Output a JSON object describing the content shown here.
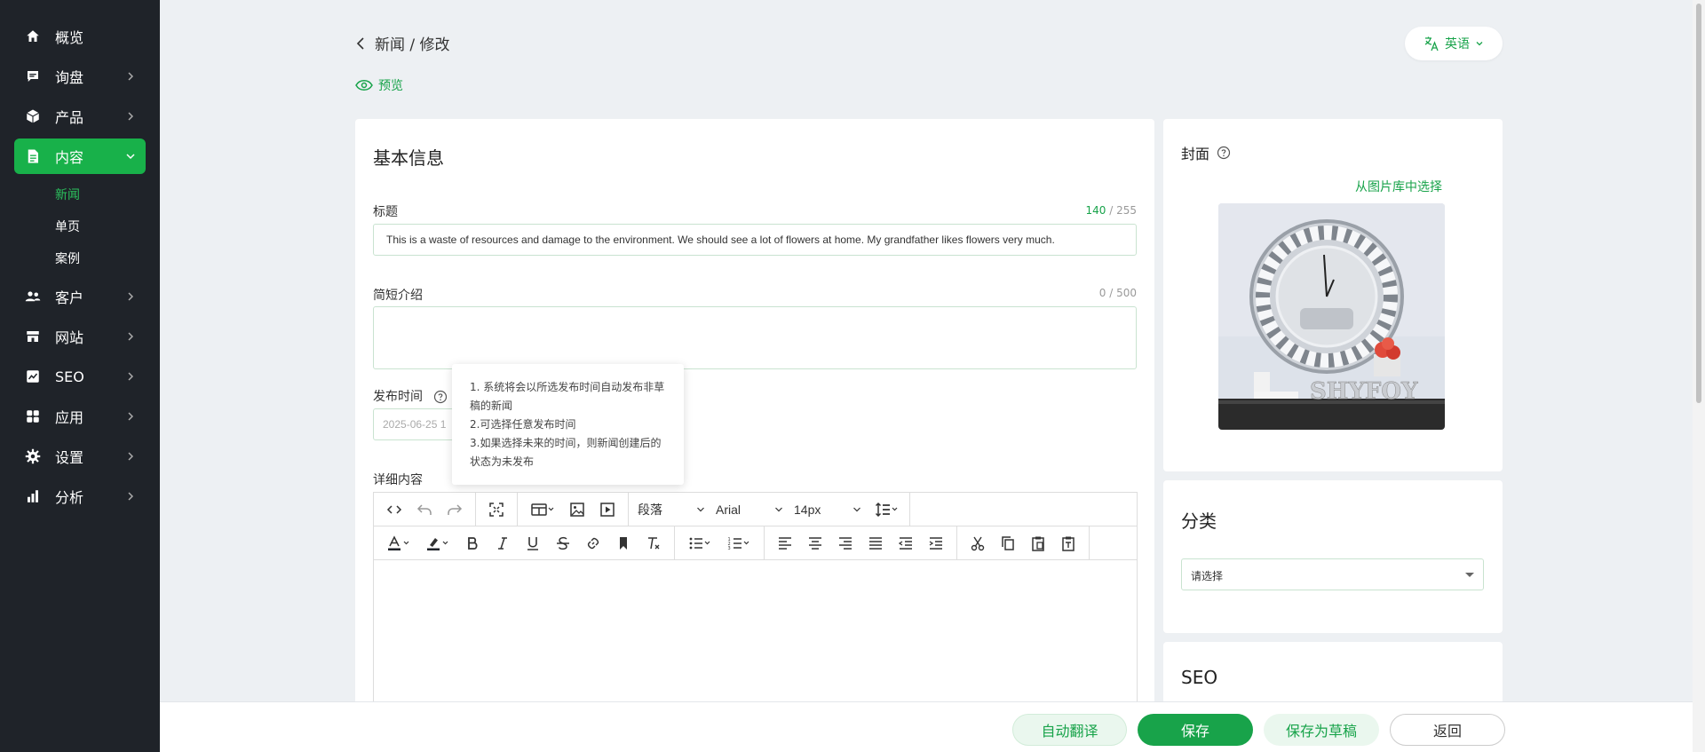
{
  "sidebar": {
    "items": [
      {
        "label": "概览",
        "icon": "home-icon"
      },
      {
        "label": "询盘",
        "icon": "message-icon"
      },
      {
        "label": "产品",
        "icon": "box-icon"
      },
      {
        "label": "内容",
        "icon": "document-icon",
        "active": true
      },
      {
        "label": "客户",
        "icon": "users-icon"
      },
      {
        "label": "网站",
        "icon": "store-icon"
      },
      {
        "label": "SEO",
        "icon": "chart-icon"
      },
      {
        "label": "应用",
        "icon": "apps-icon"
      },
      {
        "label": "设置",
        "icon": "gear-icon"
      },
      {
        "label": "分析",
        "icon": "bar-chart-icon"
      }
    ],
    "content_sub": [
      "新闻",
      "单页",
      "案例"
    ],
    "active_color": "#18b14a"
  },
  "header": {
    "breadcrumb": "新闻 / 修改",
    "preview": "预览",
    "language": "英语"
  },
  "basic": {
    "section_title": "基本信息",
    "title_label": "标题",
    "title_count_current": "140",
    "title_count_max": " / 255",
    "title_value": "This is a waste of resources and damage to the environment. We should see a lot of flowers at home. My grandfather likes flowers very much.",
    "intro_label": "简短介绍",
    "intro_count": "0 / 500",
    "publish_label": "发布时间",
    "publish_value": "2025-06-25 1",
    "detail_label": "详细内容"
  },
  "tooltip": {
    "line1": "1. 系统将会以所选发布时间自动发布非草稿的新闻",
    "line2": "2.可选择任意发布时间",
    "line3": "3.如果选择未来的时间，则新闻创建后的状态为未发布"
  },
  "editor": {
    "paragraph": "段落",
    "font": "Arial",
    "size": "14px"
  },
  "cover": {
    "title": "封面",
    "library_link": "从图片库中选择",
    "brand_watermark": "SHYFOY"
  },
  "category": {
    "title": "分类",
    "placeholder": "请选择"
  },
  "seo": {
    "title": "SEO"
  },
  "actions": {
    "auto_translate": "自动翻译",
    "save": "保存",
    "save_draft": "保存为草稿",
    "back": "返回"
  }
}
